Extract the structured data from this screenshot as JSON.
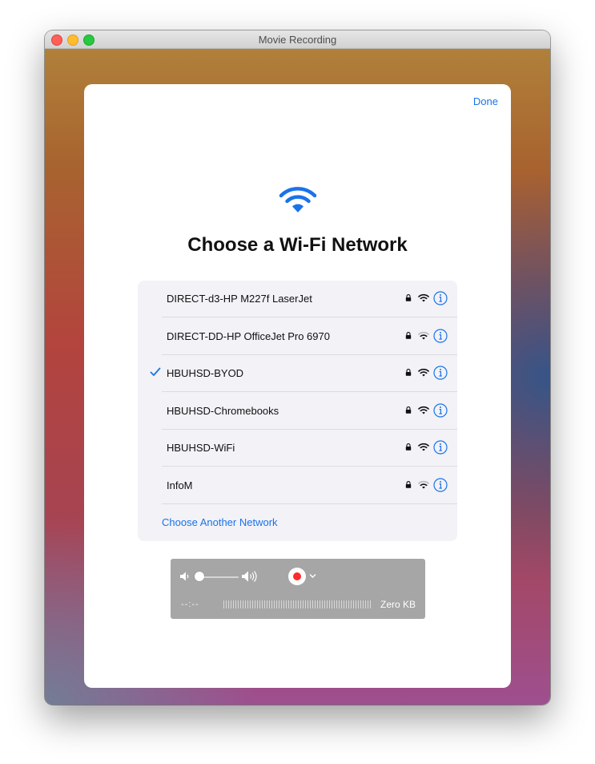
{
  "window": {
    "title": "Movie Recording",
    "controls": [
      "close",
      "minimize",
      "maximize"
    ]
  },
  "sheet": {
    "done_label": "Done",
    "hero_icon": "wifi-icon",
    "heading": "Choose a Wi-Fi Network",
    "networks": [
      {
        "name": "DIRECT-d3-HP M227f LaserJet",
        "selected": false,
        "secured": true,
        "signal": "full"
      },
      {
        "name": "DIRECT-DD-HP OfficeJet Pro 6970",
        "selected": false,
        "secured": true,
        "signal": "weak"
      },
      {
        "name": "HBUHSD-BYOD",
        "selected": true,
        "secured": true,
        "signal": "full"
      },
      {
        "name": "HBUHSD-Chromebooks",
        "selected": false,
        "secured": true,
        "signal": "full"
      },
      {
        "name": "HBUHSD-WiFi",
        "selected": false,
        "secured": true,
        "signal": "full"
      },
      {
        "name": "InfoM",
        "selected": false,
        "secured": true,
        "signal": "weak"
      }
    ],
    "other_network_label": "Choose Another Network"
  },
  "recorder": {
    "elapsed": "--:--",
    "size": "Zero KB",
    "volume_level": 0
  },
  "colors": {
    "accent": "#1a73e8",
    "record": "#ff2a2a",
    "list_bg": "#f2f2f7"
  }
}
